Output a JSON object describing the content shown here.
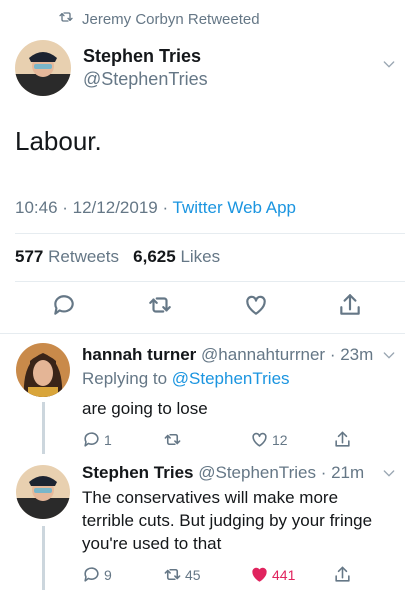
{
  "retweet_banner": {
    "text": "Jeremy Corbyn Retweeted"
  },
  "main_tweet": {
    "author": {
      "display_name": "Stephen Tries",
      "handle": "@StephenTries"
    },
    "text": "Labour.",
    "timestamp": "10:46 · 12/12/2019 · ",
    "source": "Twitter Web App",
    "stats": {
      "retweets_count": "577",
      "retweets_label": "Retweets",
      "likes_count": "6,625",
      "likes_label": "Likes"
    }
  },
  "replies": [
    {
      "display_name": "hannah turner",
      "handle": "@hannahturrner",
      "time": "23m",
      "replying_prefix": "Replying to ",
      "replying_handle": "@StephenTries",
      "text": "are going to lose",
      "reply_count": "1",
      "retweet_count": "",
      "like_count": "12"
    },
    {
      "display_name": "Stephen Tries",
      "handle": "@StephenTries",
      "time": "21m",
      "text": "The conservatives will make more terrible cuts. But judging by your fringe you're used to that",
      "reply_count": "9",
      "retweet_count": "45",
      "like_count": "441"
    }
  ],
  "colors": {
    "accent": "#1b95e0",
    "muted": "#657786",
    "like": "#e0245e",
    "divider": "#e6ecf0"
  },
  "icons": [
    "retweet-icon",
    "chevron-down-icon",
    "reply-icon",
    "like-icon",
    "share-icon"
  ]
}
